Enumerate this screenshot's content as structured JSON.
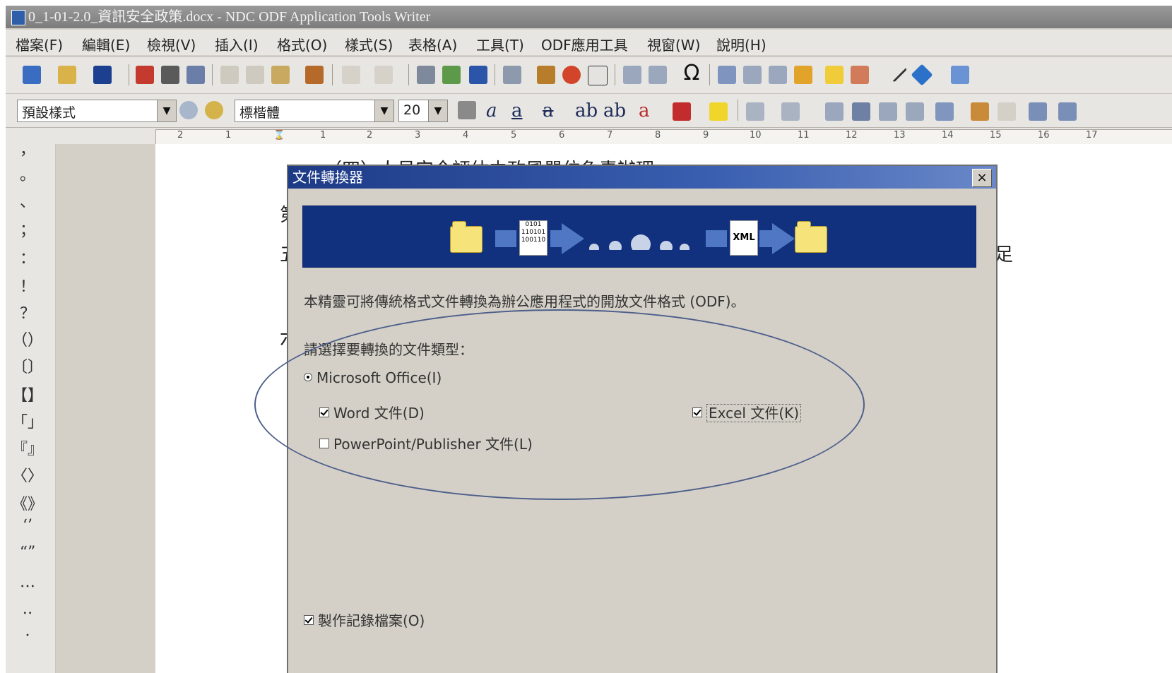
{
  "window": {
    "title": "0_1-01-2.0_資訊安全政策.docx - NDC ODF Application Tools Writer"
  },
  "menubar": {
    "items": [
      "檔案(F)",
      "編輯(E)",
      "檢視(V)",
      "插入(I)",
      "格式(O)",
      "樣式(S)",
      "表格(A)",
      "工具(T)",
      "ODF應用工具",
      "視窗(W)",
      "說明(H)"
    ]
  },
  "format_toolbar": {
    "paragraph_style": "預設樣式",
    "font_name": "標楷體",
    "font_size": "20"
  },
  "ruler": {
    "labels": [
      "2",
      "1",
      "1",
      "2",
      "3",
      "4",
      "5",
      "6",
      "7",
      "8",
      "9",
      "10",
      "11",
      "12",
      "13",
      "14",
      "15",
      "16",
      "17"
    ]
  },
  "sidebar": {
    "symbols": [
      "，",
      "。",
      "、",
      "；",
      "：",
      "！",
      "？",
      "（）",
      "〔〕",
      "【】",
      "「」",
      "『』",
      "〈〉",
      "《》",
      "‘’",
      "“”",
      "…",
      "‥",
      "·"
    ]
  },
  "document": {
    "line_1": "（四）人員安全評估由政風單位負責辦理。",
    "line_2_fragment": "第",
    "line_3_fragment": "五",
    "line_3_right": "足",
    "line_4_fragment": "六"
  },
  "dialog": {
    "title": "文件轉換器",
    "close_symbol": "×",
    "banner_doc_label": "XML",
    "intro": "本精靈可將傳統格式文件轉換為辦公應用程式的開放文件格式 (ODF)。",
    "prompt": "請選擇要轉換的文件類型：",
    "radio_ms_office": "Microsoft Office(I)",
    "word_checkbox": "Word 文件(D)",
    "excel_checkbox": "Excel 文件(K)",
    "ppt_checkbox": "PowerPoint/Publisher 文件(L)",
    "log_checkbox": "製作記錄檔案(O)",
    "radio_ms_office_selected": true,
    "word_checked": true,
    "excel_checked": true,
    "ppt_checked": false,
    "log_checked": true
  },
  "colors": {
    "banner": "#11317f",
    "titlebar_dialog": "#1d3a86",
    "annotation_ellipse": "#4d5f8a"
  }
}
